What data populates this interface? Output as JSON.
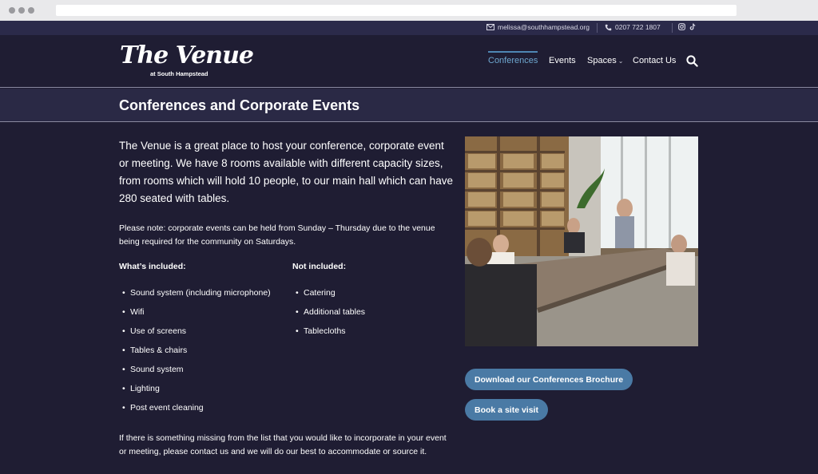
{
  "utility": {
    "email": "melissa@southhampstead.org",
    "phone": "0207 722 1807"
  },
  "logo": {
    "main": "The Venue",
    "sub": "at South Hampstead"
  },
  "nav": {
    "conferences": "Conferences",
    "events": "Events",
    "spaces": "Spaces",
    "spaces_caret": "⌄",
    "contact": "Contact Us"
  },
  "page": {
    "title": "Conferences and Corporate Events",
    "intro": "The Venue is a great place to host your conference, corporate event or meeting. We have 8 rooms available with different capacity sizes, from rooms which will hold 10 people, to our main hall which can have 280 seated with tables.",
    "note": "Please note: corporate events can be held from Sunday – Thursday due to the venue being required for the community on Saturdays.",
    "included_heading": "What’s included:",
    "not_included_heading": "Not included:",
    "included": [
      "Sound system (including microphone)",
      "Wifi",
      "Use of screens",
      "Tables & chairs",
      "Sound system",
      "Lighting",
      "Post event cleaning"
    ],
    "not_included": [
      "Catering",
      "Additional tables",
      "Tablecloths"
    ],
    "footer_note": "If there is something missing from the list that you would like to incorporate in your event or meeting, please contact us and we will do our best to accommodate or source it."
  },
  "buttons": {
    "brochure": "Download our Conferences Brochure",
    "site_visit": "Book a site visit"
  },
  "colors": {
    "background": "#1f1d33",
    "title_band": "#2a2945",
    "accent": "#4a7aa5",
    "nav_active": "#6ea7cf"
  },
  "icons": [
    "mail-icon",
    "phone-icon",
    "instagram-icon",
    "tiktok-icon",
    "search-icon"
  ]
}
